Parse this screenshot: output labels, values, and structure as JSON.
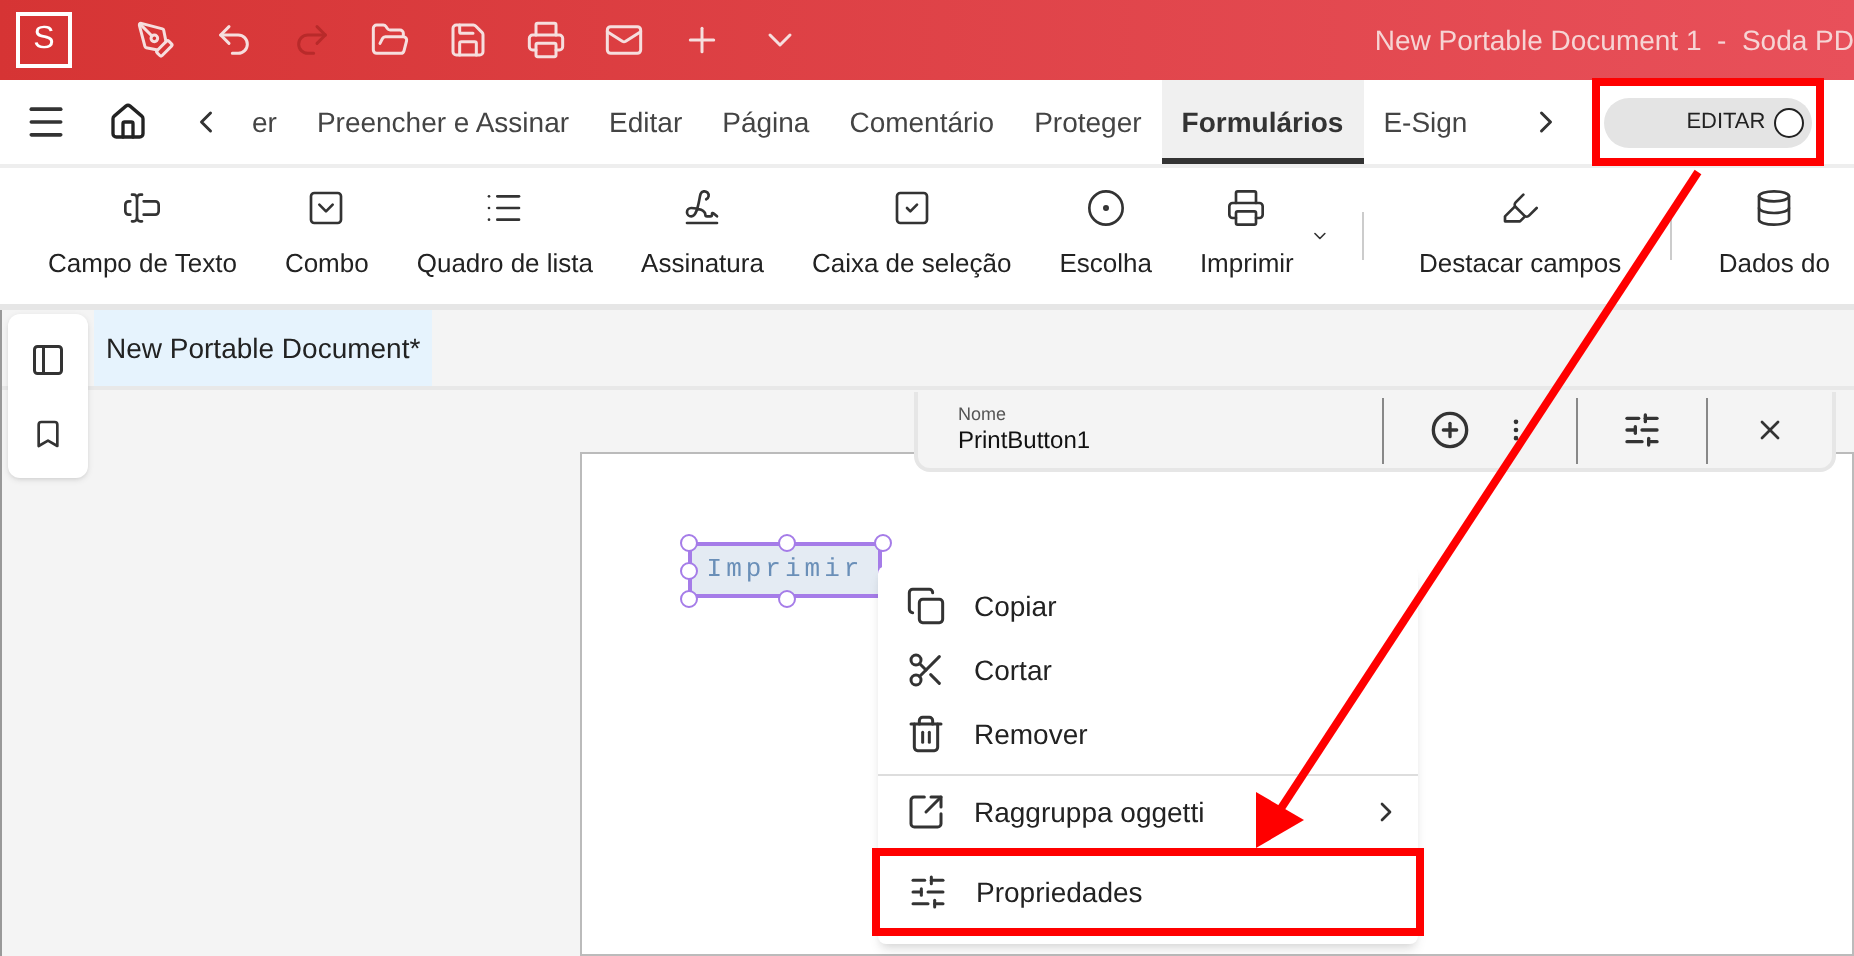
{
  "app": {
    "logo": "S",
    "title": "New Portable Document 1  -  Soda PD"
  },
  "tabs": [
    {
      "label": "er",
      "selected": false
    },
    {
      "label": "Preencher e Assinar",
      "selected": false
    },
    {
      "label": "Editar",
      "selected": false
    },
    {
      "label": "Página",
      "selected": false
    },
    {
      "label": "Comentário",
      "selected": false
    },
    {
      "label": "Proteger",
      "selected": false
    },
    {
      "label": "Formulários",
      "selected": true
    },
    {
      "label": "E-Sign",
      "selected": false
    }
  ],
  "edit_toggle": {
    "label": "EDITAR",
    "on": false
  },
  "tools": [
    {
      "label": "Campo de Texto"
    },
    {
      "label": "Combo"
    },
    {
      "label": "Quadro de lista"
    },
    {
      "label": "Assinatura"
    },
    {
      "label": "Caixa de seleção"
    },
    {
      "label": "Escolha"
    },
    {
      "label": "Imprimir"
    },
    {
      "label": "Destacar campos"
    },
    {
      "label": "Dados do"
    }
  ],
  "document_tab": {
    "label": "New Portable Document*"
  },
  "property_bar": {
    "field_label": "Nome",
    "field_value": "PrintButton1"
  },
  "form_field": {
    "label": "Imprimir"
  },
  "context_menu": [
    {
      "label": "Copiar",
      "submenu": false
    },
    {
      "label": "Cortar",
      "submenu": false
    },
    {
      "label": "Remover",
      "submenu": false
    },
    {
      "label": "Raggruppa oggetti",
      "submenu": true
    },
    {
      "label": "Propriedades",
      "submenu": false
    }
  ]
}
